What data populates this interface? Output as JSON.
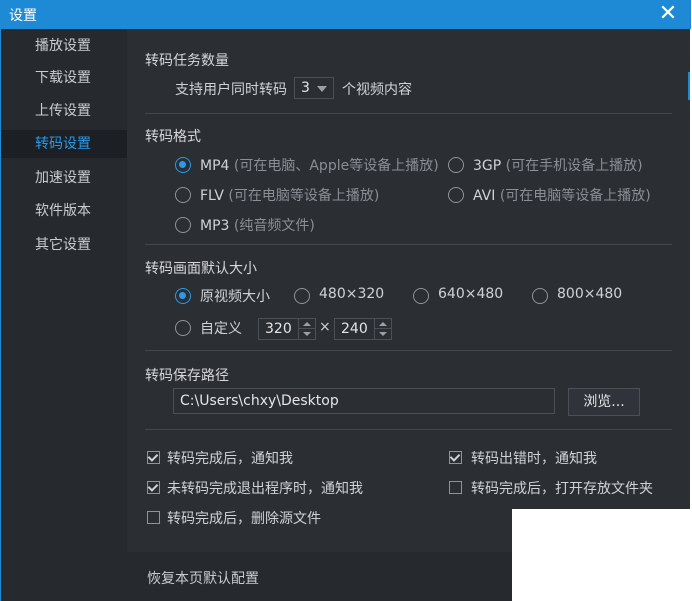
{
  "window": {
    "title": "设置"
  },
  "sidebar": {
    "items": [
      {
        "label": "播放设置"
      },
      {
        "label": "下载设置"
      },
      {
        "label": "上传设置"
      },
      {
        "label": "转码设置",
        "active": true
      },
      {
        "label": "加速设置"
      },
      {
        "label": "软件版本"
      },
      {
        "label": "其它设置"
      }
    ]
  },
  "tasks": {
    "title": "转码任务数量",
    "prefix": "支持用户同时转码",
    "value": "3",
    "suffix": "个视频内容"
  },
  "format": {
    "title": "转码格式",
    "options": [
      {
        "name": "MP4",
        "hint": "(可在电脑、Apple等设备上播放)",
        "selected": true
      },
      {
        "name": "3GP",
        "hint": "(可在手机设备上播放)",
        "selected": false
      },
      {
        "name": "FLV",
        "hint": "(可在电脑等设备上播放)",
        "selected": false
      },
      {
        "name": "AVI",
        "hint": "(可在电脑等设备上播放)",
        "selected": false
      },
      {
        "name": "MP3",
        "hint": "(纯音频文件)",
        "selected": false
      }
    ]
  },
  "size": {
    "title": "转码画面默认大小",
    "options": [
      {
        "label": "原视频大小",
        "selected": true
      },
      {
        "label": "480×320",
        "selected": false
      },
      {
        "label": "640×480",
        "selected": false
      },
      {
        "label": "800×480",
        "selected": false
      },
      {
        "label": "自定义",
        "selected": false
      }
    ],
    "width": "320",
    "times": "×",
    "height": "240"
  },
  "path": {
    "title": "转码保存路径",
    "value": "C:\\Users\\chxy\\Desktop",
    "browse": "浏览..."
  },
  "checks": [
    {
      "label": "转码完成后，通知我",
      "checked": true
    },
    {
      "label": "转码出错时，通知我",
      "checked": true
    },
    {
      "label": "未转码完成退出程序时，通知我",
      "checked": true
    },
    {
      "label": "转码完成后，打开存放文件夹",
      "checked": false
    },
    {
      "label": "转码完成后，删除源文件",
      "checked": false
    }
  ],
  "footer": {
    "restore": "恢复本页默认配置"
  },
  "colors": {
    "accent": "#1e8ad6",
    "panel": "#2b2e33",
    "sidebar": "#26292e"
  }
}
